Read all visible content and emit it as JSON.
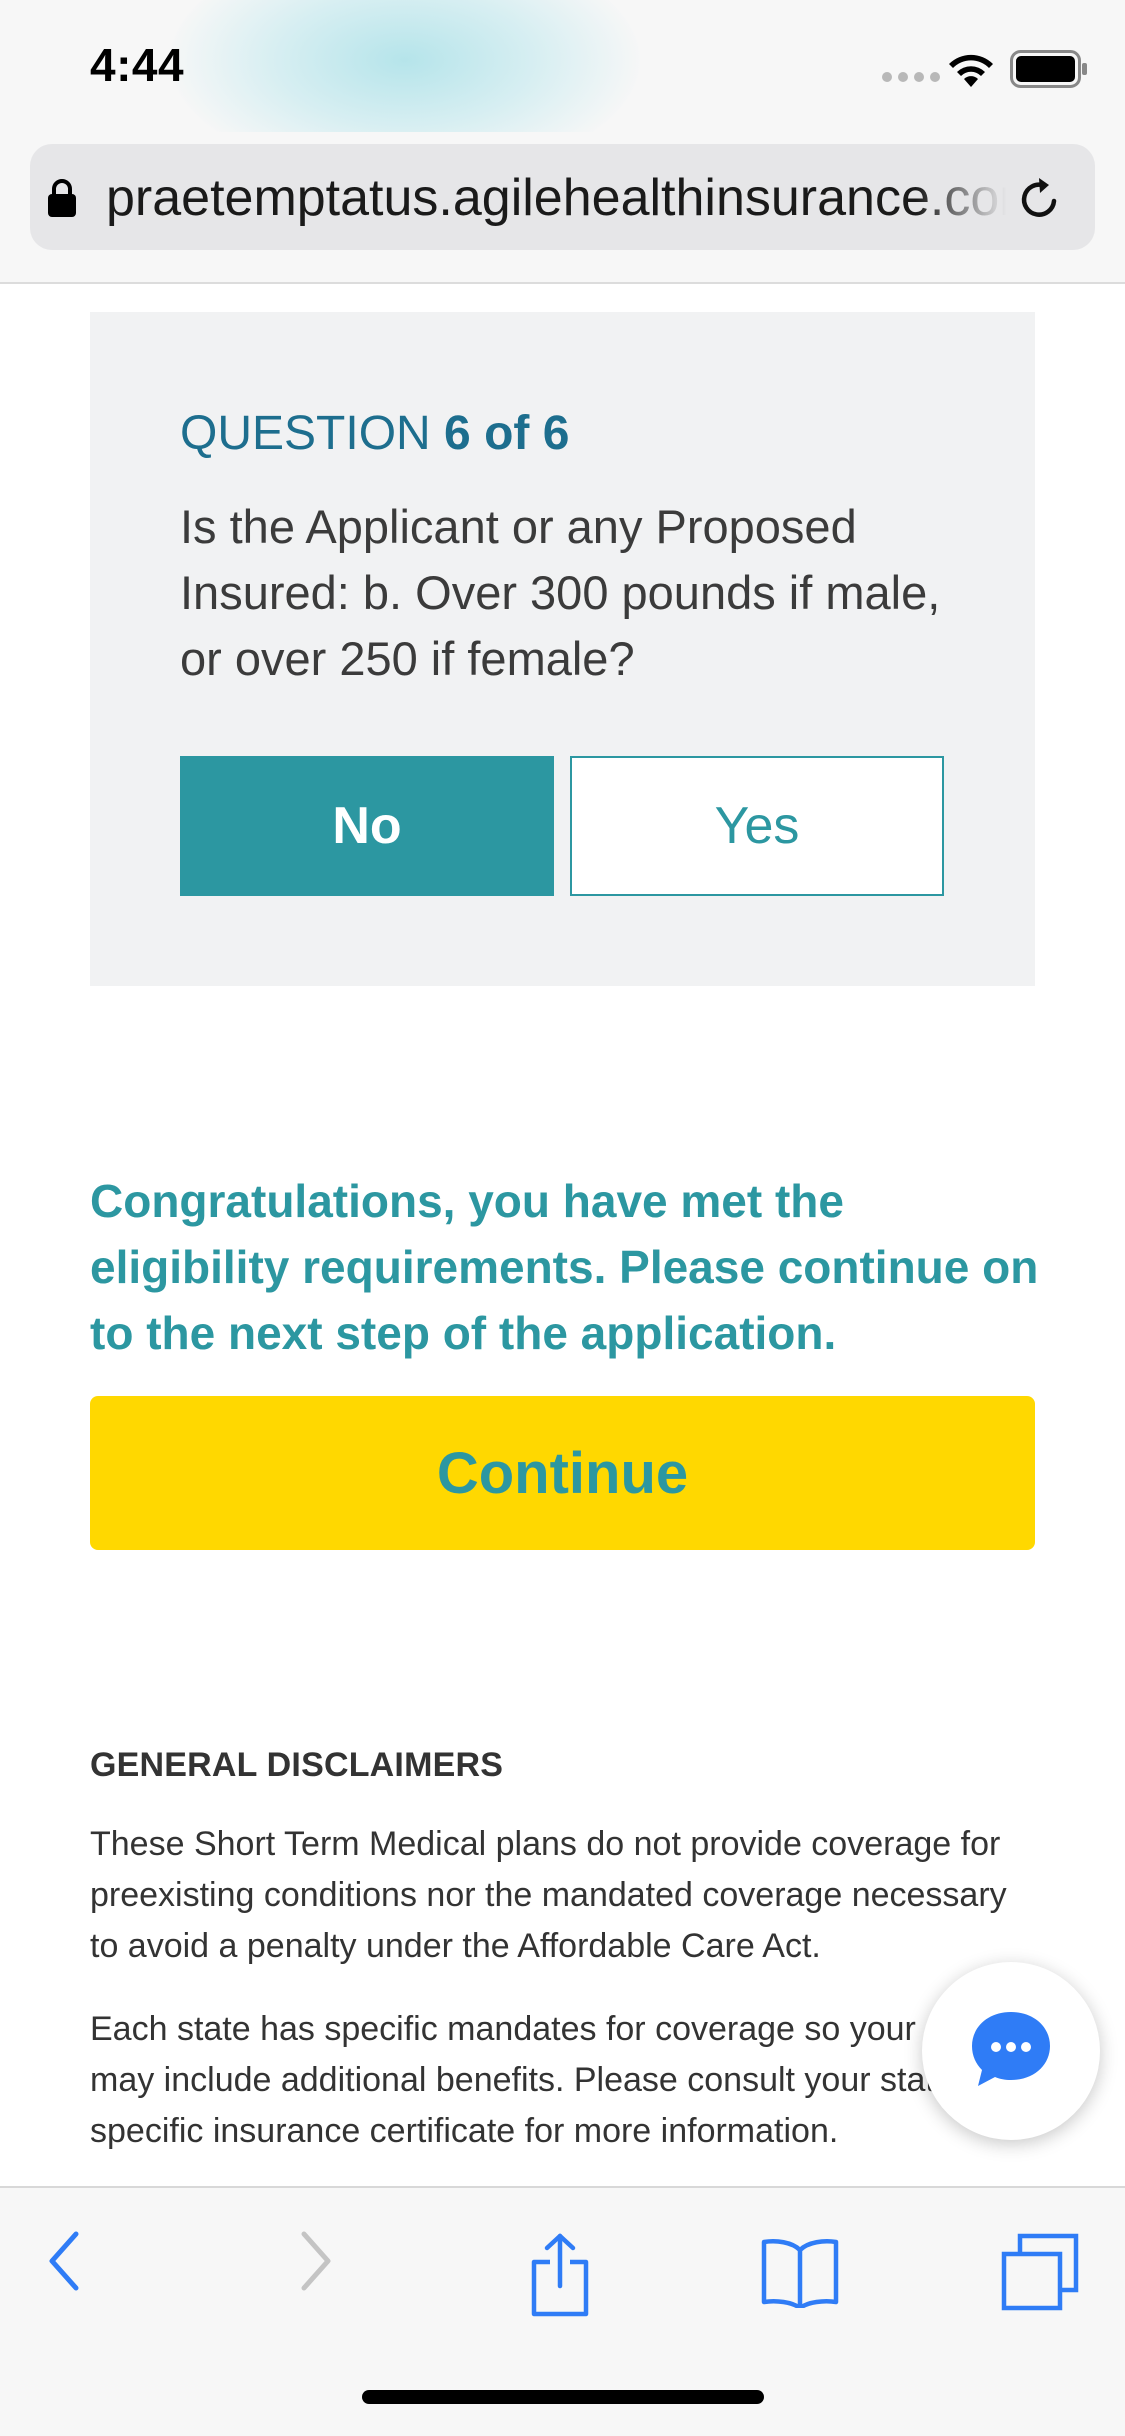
{
  "status_bar": {
    "time": "4:44"
  },
  "browser": {
    "url": "praetemptatus.agilehealthinsurance.com",
    "icons": [
      "lock-icon",
      "reload-icon"
    ]
  },
  "question": {
    "label_prefix": "QUESTION",
    "label_count": "6 of 6",
    "text": "Is the Applicant or any Proposed Insured: b. Over 300 pounds if male, or over 250 if female?",
    "answers": [
      {
        "label": "No",
        "selected": true
      },
      {
        "label": "Yes",
        "selected": false
      }
    ]
  },
  "result": {
    "message": "Congratulations, you have met the eligibility requirements. Please continue on to the next step of the application.",
    "continue_label": "Continue"
  },
  "disclaimers": {
    "heading": "GENERAL DISCLAIMERS",
    "paragraph_1": "These Short Term Medical plans do not provide coverage for preexisting conditions nor the mandated coverage necessary to avoid a penalty under the Affordable Care Act.",
    "paragraph_2": "Each state has specific mandates for coverage so your plan may include additional benefits. Please consult your state-specific insurance certificate for more information."
  },
  "chat": {
    "icon": "chat-bubble-icon"
  },
  "toolbar": {
    "icons": [
      "back-icon",
      "forward-icon",
      "share-icon",
      "bookmarks-icon",
      "tabs-icon"
    ]
  },
  "colors": {
    "accent_teal": "#2c97a1",
    "question_blue": "#1d6e8e",
    "continue_yellow": "#ffd800",
    "ios_blue": "#2f7cf6",
    "card_gray": "#f1f2f3"
  }
}
